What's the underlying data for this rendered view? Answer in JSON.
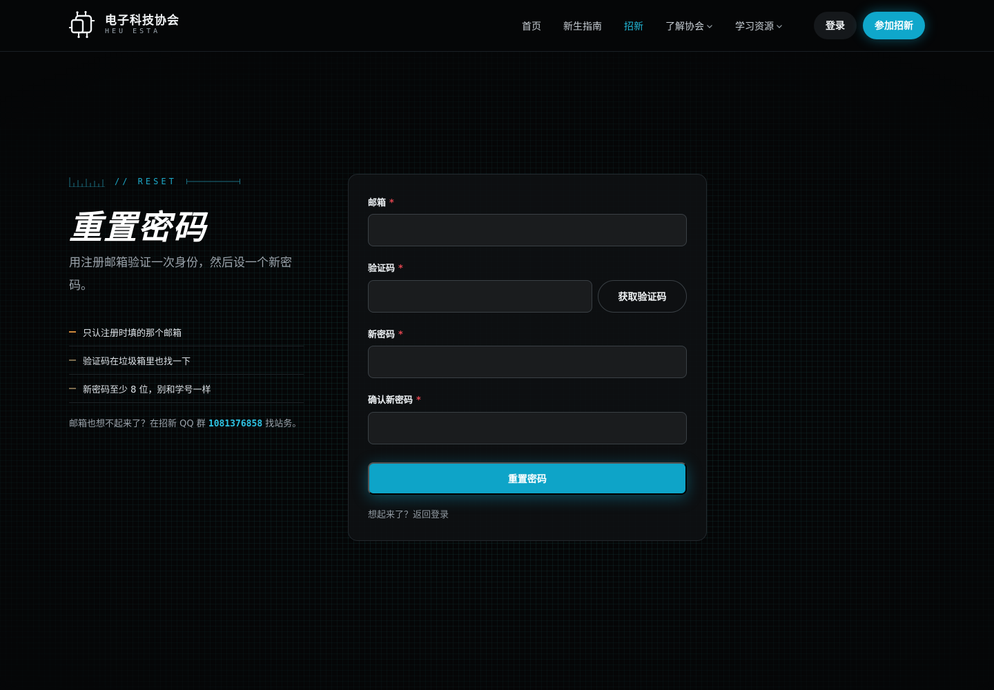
{
  "header": {
    "logo_title": "电子科技协会",
    "logo_sub": "HEU ESTA",
    "nav": [
      {
        "label": "首页",
        "active": false,
        "dropdown": false
      },
      {
        "label": "新生指南",
        "active": false,
        "dropdown": false
      },
      {
        "label": "招新",
        "active": true,
        "dropdown": false
      },
      {
        "label": "了解协会",
        "active": false,
        "dropdown": true
      },
      {
        "label": "学习资源",
        "active": false,
        "dropdown": true
      }
    ],
    "login_label": "登录",
    "join_label": "参加招新"
  },
  "intro": {
    "eyebrow": "// RESET",
    "title": "重置密码",
    "description": "用注册邮箱验证一次身份，然后设一个新密码。",
    "tips": [
      "只认注册时填的那个邮箱",
      "验证码在垃圾箱里也找一下",
      "新密码至少 8 位，别和学号一样"
    ],
    "help_prefix": "邮箱也想不起来了？在招新 QQ 群",
    "help_qq": "1081376858",
    "help_suffix": "找站务。"
  },
  "form": {
    "email_label": "邮箱",
    "code_label": "验证码",
    "new_password_label": "新密码",
    "confirm_password_label": "确认新密码",
    "required_mark": "*",
    "email_value": "",
    "code_value": "",
    "new_password_value": "",
    "confirm_password_value": "",
    "get_code_label": "获取验证码",
    "submit_label": "重置密码",
    "back_prompt": "想起来了？",
    "back_link": "返回登录"
  },
  "colors": {
    "accent": "#0ea4c8",
    "accent_text": "#22b8d8",
    "required": "#e0454f",
    "tip_dash": "#d08a3c",
    "background": "#050607"
  },
  "icons": {
    "logo": "circuit-logo-icon",
    "dropdown": "chevron-down-icon"
  }
}
